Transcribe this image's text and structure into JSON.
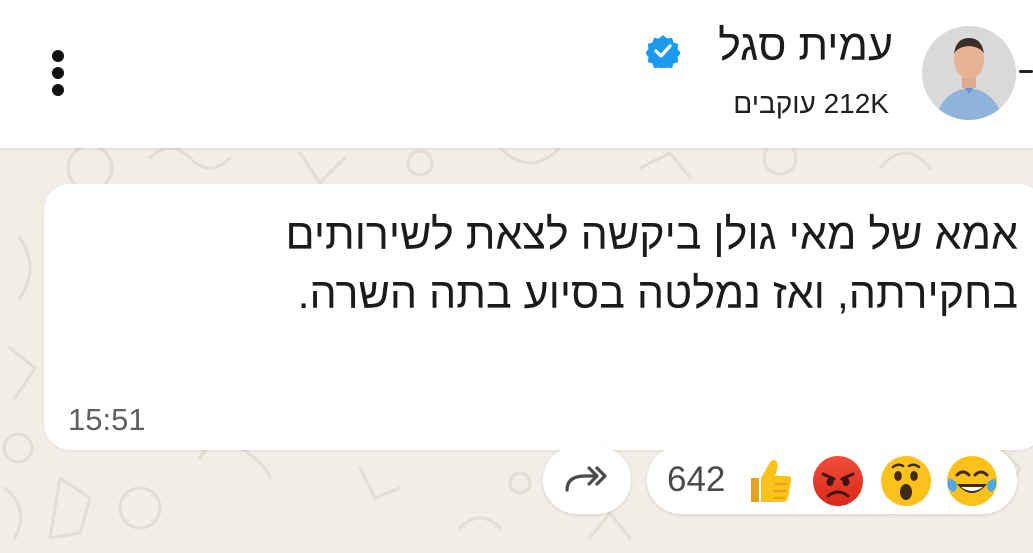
{
  "header": {
    "channel_name": "עמית סגל",
    "followers": "212K עוקבים"
  },
  "message": {
    "text": "אמא של מאי גולן ביקשה לצאת לשירותים בחקירתה, ואז נמלטה בסיוע בתה השרה.",
    "time": "15:51"
  },
  "reactions": {
    "count": "642",
    "emojis": [
      "laughing-emoji",
      "surprised-emoji",
      "angry-emoji",
      "thumbs-up-emoji"
    ]
  },
  "colors": {
    "background": "#f2ede6",
    "verified_badge": "#1a9bf0",
    "bubble": "#ffffff"
  }
}
